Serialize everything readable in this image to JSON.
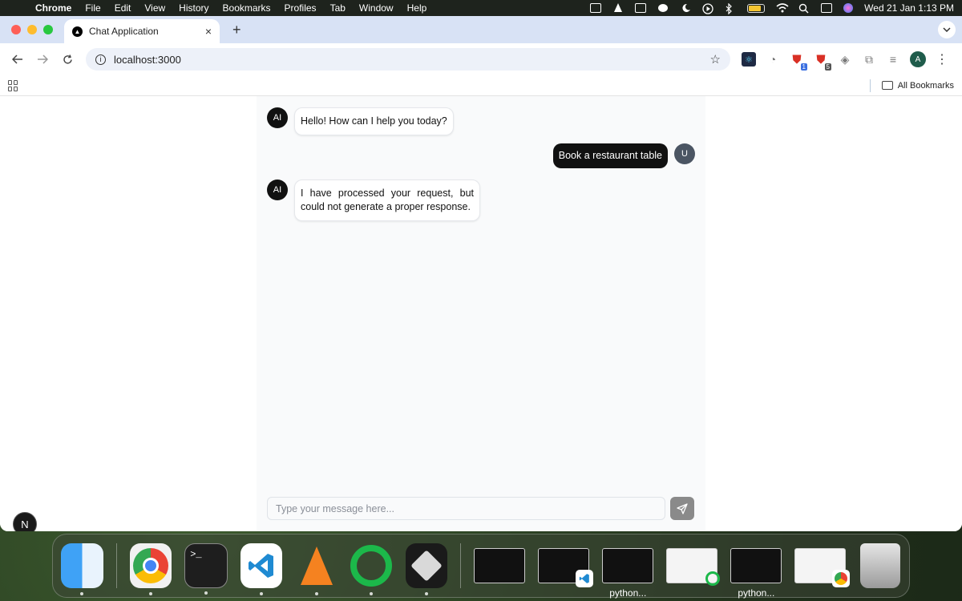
{
  "menubar": {
    "app_name": "Chrome",
    "menus": [
      "File",
      "Edit",
      "View",
      "History",
      "Bookmarks",
      "Profiles",
      "Tab",
      "Window",
      "Help"
    ],
    "clock": "Wed 21 Jan  1:13 PM"
  },
  "browser": {
    "tab_title": "Chat Application",
    "tab_favicon": "▲",
    "tab_close": "×",
    "new_tab": "+",
    "url": "localhost:3000",
    "extension_badges": [
      "1",
      "5"
    ],
    "profile_initial": "A",
    "bookmarks_label": "All Bookmarks"
  },
  "chat": {
    "messages": [
      {
        "role": "ai",
        "avatar": "AI",
        "text": "Hello! How can I help you today?"
      },
      {
        "role": "user",
        "avatar": "U",
        "text": "Book a restaurant table"
      },
      {
        "role": "ai",
        "avatar": "AI",
        "text": "I have processed your request, but could not generate a proper response."
      }
    ],
    "input_placeholder": "Type your message here..."
  },
  "next_badge": "N",
  "dock": {
    "terminal_prompt": ">_",
    "thumbnail_labels": [
      "python...",
      "python..."
    ]
  },
  "colors": {
    "user_bubble": "#111111",
    "send_button": "#8a8a8a",
    "chat_background": "#f9fafb"
  }
}
